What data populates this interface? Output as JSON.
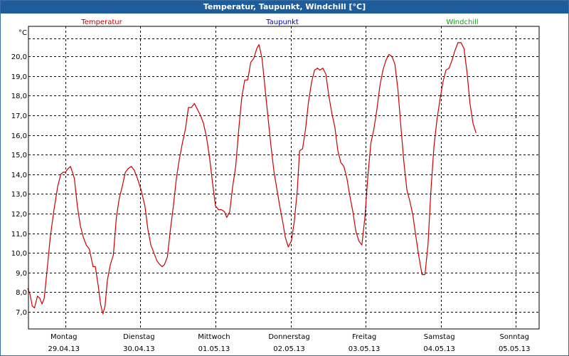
{
  "title": "Temperatur, Taupunkt, Windchill [°C]",
  "chart_data": {
    "type": "line",
    "y_unit": "°C",
    "ylim": [
      6.5,
      21.0
    ],
    "y_ticks": [
      "7,0",
      "8,0",
      "9,0",
      "10,0",
      "11,0",
      "12,0",
      "13,0",
      "14,0",
      "15,0",
      "16,0",
      "17,0",
      "18,0",
      "19,0",
      "20,0"
    ],
    "y_tick_values": [
      7,
      8,
      9,
      10,
      11,
      12,
      13,
      14,
      15,
      16,
      17,
      18,
      19,
      20
    ],
    "xlim": [
      0,
      7
    ],
    "x_ticks": [
      {
        "x": 0,
        "day": "Montag",
        "date": "29.04.13"
      },
      {
        "x": 1,
        "day": "Dienstag",
        "date": "30.04.13"
      },
      {
        "x": 2,
        "day": "Mittwoch",
        "date": "01.05.13"
      },
      {
        "x": 3,
        "day": "Donnerstag",
        "date": "02.05.13"
      },
      {
        "x": 4,
        "day": "Freitag",
        "date": "03.05.13"
      },
      {
        "x": 5,
        "day": "Samstag",
        "date": "04.05.13"
      },
      {
        "x": 6,
        "day": "Sonntag",
        "date": "05.05.13"
      }
    ],
    "grid": true,
    "legend_placement": "top",
    "series": [
      {
        "name": "Temperatur",
        "color": "#cc0000",
        "points": [
          [
            0.0,
            8.2
          ],
          [
            0.03,
            7.9
          ],
          [
            0.06,
            7.3
          ],
          [
            0.09,
            7.2
          ],
          [
            0.13,
            7.8
          ],
          [
            0.16,
            7.7
          ],
          [
            0.19,
            7.4
          ],
          [
            0.22,
            7.7
          ],
          [
            0.26,
            9.2
          ],
          [
            0.3,
            10.8
          ],
          [
            0.35,
            12.2
          ],
          [
            0.4,
            13.4
          ],
          [
            0.44,
            14.0
          ],
          [
            0.47,
            14.1
          ],
          [
            0.5,
            14.1
          ],
          [
            0.54,
            14.3
          ],
          [
            0.57,
            14.4
          ],
          [
            0.62,
            13.8
          ],
          [
            0.66,
            12.4
          ],
          [
            0.7,
            11.4
          ],
          [
            0.74,
            10.8
          ],
          [
            0.78,
            10.4
          ],
          [
            0.82,
            10.2
          ],
          [
            0.87,
            9.3
          ],
          [
            0.9,
            9.3
          ],
          [
            0.94,
            8.3
          ],
          [
            0.97,
            7.4
          ],
          [
            1.0,
            6.9
          ],
          [
            1.03,
            7.3
          ],
          [
            1.06,
            8.6
          ],
          [
            1.1,
            9.4
          ],
          [
            1.14,
            9.9
          ],
          [
            1.18,
            11.8
          ],
          [
            1.22,
            12.8
          ],
          [
            1.26,
            13.4
          ],
          [
            1.3,
            14.1
          ],
          [
            1.34,
            14.3
          ],
          [
            1.38,
            14.4
          ],
          [
            1.42,
            14.2
          ],
          [
            1.46,
            13.8
          ],
          [
            1.51,
            13.2
          ],
          [
            1.56,
            12.4
          ],
          [
            1.6,
            11.2
          ],
          [
            1.64,
            10.4
          ],
          [
            1.68,
            10.0
          ],
          [
            1.72,
            9.6
          ],
          [
            1.76,
            9.4
          ],
          [
            1.79,
            9.3
          ],
          [
            1.82,
            9.4
          ],
          [
            1.86,
            9.8
          ],
          [
            1.9,
            11.2
          ],
          [
            1.94,
            12.4
          ],
          [
            1.98,
            13.8
          ],
          [
            2.02,
            14.8
          ],
          [
            2.06,
            15.6
          ],
          [
            2.1,
            16.3
          ],
          [
            2.14,
            17.4
          ],
          [
            2.18,
            17.4
          ],
          [
            2.22,
            17.6
          ],
          [
            2.26,
            17.3
          ],
          [
            2.3,
            17.0
          ],
          [
            2.34,
            16.6
          ],
          [
            2.38,
            15.9
          ],
          [
            2.42,
            14.9
          ],
          [
            2.46,
            13.6
          ],
          [
            2.5,
            12.4
          ],
          [
            2.54,
            12.2
          ],
          [
            2.58,
            12.2
          ],
          [
            2.62,
            12.1
          ],
          [
            2.65,
            11.8
          ],
          [
            2.69,
            12.1
          ],
          [
            2.73,
            13.4
          ],
          [
            2.77,
            14.4
          ],
          [
            2.81,
            16.3
          ],
          [
            2.85,
            17.9
          ],
          [
            2.89,
            18.8
          ],
          [
            2.93,
            18.8
          ],
          [
            2.97,
            19.7
          ],
          [
            3.01,
            19.9
          ],
          [
            3.05,
            20.4
          ],
          [
            3.08,
            20.6
          ],
          [
            3.12,
            19.9
          ],
          [
            3.16,
            18.4
          ],
          [
            3.2,
            16.9
          ],
          [
            3.24,
            15.4
          ],
          [
            3.28,
            14.1
          ],
          [
            3.32,
            13.2
          ],
          [
            3.36,
            12.3
          ],
          [
            3.4,
            11.5
          ],
          [
            3.43,
            10.8
          ],
          [
            3.47,
            10.3
          ],
          [
            3.51,
            10.6
          ],
          [
            3.55,
            11.6
          ],
          [
            3.59,
            13.2
          ],
          [
            3.62,
            15.2
          ],
          [
            3.66,
            15.3
          ],
          [
            3.7,
            16.3
          ],
          [
            3.74,
            17.7
          ],
          [
            3.78,
            18.7
          ],
          [
            3.82,
            19.3
          ],
          [
            3.86,
            19.4
          ],
          [
            3.89,
            19.3
          ],
          [
            3.93,
            19.4
          ],
          [
            3.97,
            19.1
          ],
          [
            4.01,
            18.0
          ],
          [
            4.05,
            17.1
          ],
          [
            4.09,
            16.4
          ],
          [
            4.13,
            15.2
          ],
          [
            4.17,
            14.6
          ],
          [
            4.21,
            14.4
          ],
          [
            4.25,
            13.8
          ],
          [
            4.29,
            12.9
          ],
          [
            4.33,
            12.1
          ],
          [
            4.37,
            11.1
          ],
          [
            4.41,
            10.6
          ],
          [
            4.45,
            10.4
          ],
          [
            4.49,
            11.8
          ],
          [
            4.53,
            13.9
          ],
          [
            4.57,
            15.6
          ],
          [
            4.61,
            16.3
          ],
          [
            4.65,
            17.3
          ],
          [
            4.69,
            18.5
          ],
          [
            4.73,
            19.3
          ],
          [
            4.77,
            19.8
          ],
          [
            4.81,
            20.1
          ],
          [
            4.85,
            20.0
          ],
          [
            4.89,
            19.6
          ],
          [
            4.93,
            18.3
          ],
          [
            4.97,
            16.4
          ],
          [
            5.01,
            14.6
          ],
          [
            5.05,
            13.2
          ],
          [
            5.09,
            12.6
          ],
          [
            5.13,
            11.9
          ],
          [
            5.17,
            10.8
          ],
          [
            5.21,
            9.8
          ],
          [
            5.25,
            8.9
          ],
          [
            5.29,
            8.9
          ],
          [
            5.33,
            10.4
          ],
          [
            5.37,
            13.2
          ],
          [
            5.41,
            15.4
          ],
          [
            5.45,
            16.8
          ],
          [
            5.49,
            17.8
          ],
          [
            5.53,
            18.7
          ],
          [
            5.57,
            19.3
          ],
          [
            5.61,
            19.4
          ],
          [
            5.65,
            19.8
          ],
          [
            5.69,
            20.3
          ],
          [
            5.73,
            20.7
          ],
          [
            5.77,
            20.7
          ],
          [
            5.81,
            20.4
          ],
          [
            5.85,
            19.2
          ],
          [
            5.89,
            17.6
          ],
          [
            5.93,
            16.6
          ],
          [
            5.97,
            16.1
          ]
        ]
      },
      {
        "name": "Taupunkt",
        "color": "#0000cc",
        "points": []
      },
      {
        "name": "Windchill",
        "color": "#00aa00",
        "points": []
      }
    ]
  }
}
